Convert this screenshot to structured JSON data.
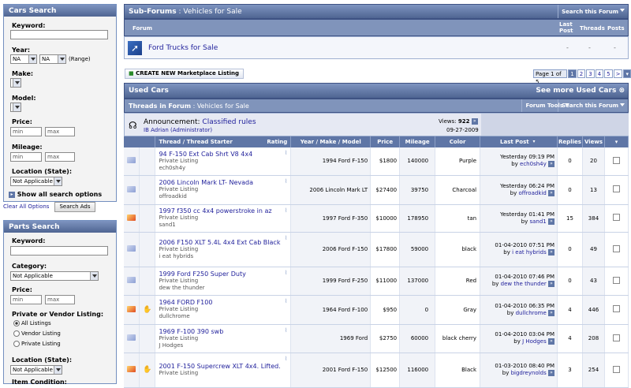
{
  "cars_search": {
    "title": "Cars Search",
    "keyword_label": "Keyword:",
    "year_label": "Year:",
    "year_from": "NA",
    "year_to": "NA",
    "range": "(Range)",
    "make_label": "Make:",
    "model_label": "Model:",
    "price_label": "Price:",
    "min": "min",
    "max": "max",
    "mileage_label": "Mileage:",
    "location_label": "Location (State):",
    "location_value": "Not Applicable",
    "show_all": "Show all search options",
    "clear": "Clear All Options",
    "search_ads": "Search Ads"
  },
  "parts_search": {
    "title": "Parts Search",
    "keyword_label": "Keyword:",
    "category_label": "Category:",
    "category_value": "Not Applicable",
    "price_label": "Price:",
    "min": "min",
    "max": "max",
    "vendor_label": "Private or Vendor Listing:",
    "options": [
      "All Listings",
      "Vendor Listing",
      "Private Listing"
    ],
    "location_label": "Location (State):",
    "location_value": "Not Applicable",
    "condition_label": "Item Condition:"
  },
  "subforums": {
    "title": "Sub-Forums",
    "crumb": "Vehicles for Sale",
    "search": "Search this Forum",
    "col_forum": "Forum",
    "col_last_post": "Last Post",
    "col_threads": "Threads",
    "col_posts": "Posts",
    "row_name": "Ford Trucks for Sale",
    "row_last": "-",
    "row_threads": "-",
    "row_posts": "-"
  },
  "listing_btn": "CREATE NEW Marketplace Listing",
  "pagination": {
    "label": "Page 1 of 5",
    "pages": [
      "1",
      "2",
      "3",
      "4",
      "5",
      ">"
    ]
  },
  "used_cars": {
    "title": "Used Cars",
    "more": "See more Used Cars"
  },
  "threads_bar": {
    "title": "Threads in Forum",
    "crumb": "Vehicles for Sale",
    "tools": "Forum Tools",
    "search": "Search this Forum"
  },
  "announcement": {
    "label": "Announcement:",
    "title": "Classified rules",
    "author": "IB Adrian (Administrator)",
    "views_label": "Views:",
    "views": "922",
    "date": "09-27-2009"
  },
  "columns": {
    "thread": "Thread / Thread Starter",
    "rating": "Rating",
    "ymm": "Year / Make / Model",
    "price": "Price",
    "mileage": "Mileage",
    "color": "Color",
    "last_post": "Last Post",
    "replies": "Replies",
    "views": "Views"
  },
  "rows": [
    {
      "title": "94 F-150 Ext Cab Shrt V8 4x4",
      "type": "Private Listing",
      "starter": "ech0sh4y",
      "ymm": "1994 Ford F-150",
      "price": "$1800",
      "mileage": "140000",
      "color": "Purple",
      "date": "Yesterday 09:19 PM",
      "by": "ech0sh4y",
      "replies": "0",
      "views": "20",
      "icon": "blue"
    },
    {
      "title": "2006 Lincoln Mark LT- Nevada",
      "type": "Private Listing",
      "starter": "offroadkid",
      "ymm": "2006 Lincoln Mark LT",
      "price": "$27400",
      "mileage": "39750",
      "color": "Charcoal",
      "date": "Yesterday 06:24 PM",
      "by": "offroadkid",
      "replies": "0",
      "views": "13",
      "icon": "blue"
    },
    {
      "title": "1997 f350 cc 4x4 powerstroke in az",
      "type": "Private Listing",
      "starter": "sand1",
      "ymm": "1997 Ford F-350",
      "price": "$10000",
      "mileage": "178950",
      "color": "tan",
      "date": "Yesterday 01:41 PM",
      "by": "sand1",
      "replies": "15",
      "views": "384",
      "icon": "red"
    },
    {
      "title": "2006 F150 XLT 5.4L 4x4 Ext Cab Black",
      "type": "Private Listing",
      "starter": "i eat hybrids",
      "ymm": "2006 Ford F-150",
      "price": "$17800",
      "mileage": "59000",
      "color": "black",
      "date": "01-04-2010 07:51 PM",
      "by": "i eat hybrids",
      "replies": "0",
      "views": "49",
      "icon": "blue"
    },
    {
      "title": "1999 Ford F250 Super Duty",
      "type": "Private Listing",
      "starter": "dew the thunder",
      "ymm": "1999 Ford F-250",
      "price": "$11000",
      "mileage": "137000",
      "color": "Red",
      "date": "01-04-2010 07:46 PM",
      "by": "dew the thunder",
      "replies": "0",
      "views": "43",
      "icon": "blue"
    },
    {
      "title": "1964 FORD F100",
      "type": "Private Listing",
      "starter": "dullchrome",
      "ymm": "1964 Ford F-100",
      "price": "$950",
      "mileage": "0",
      "color": "Gray",
      "date": "01-04-2010 06:35 PM",
      "by": "dullchrome",
      "replies": "4",
      "views": "446",
      "icon": "red"
    },
    {
      "title": "1969 F-100 390 swb",
      "type": "Private Listing",
      "starter": "J Hodges",
      "ymm": "1969 Ford",
      "price": "$2750",
      "mileage": "60000",
      "color": "black cherry",
      "date": "01-04-2010 03:04 PM",
      "by": "J Hodges",
      "replies": "4",
      "views": "208",
      "icon": "blue"
    },
    {
      "title": "2001 F-150 Supercrew XLT 4x4. Lifted.",
      "type": "Private Listing",
      "starter": "",
      "ymm": "2001 Ford F-150",
      "price": "$12500",
      "mileage": "116000",
      "color": "Black",
      "date": "01-03-2010 08:40 PM",
      "by": "bigdreynolds",
      "replies": "3",
      "views": "254",
      "icon": "red"
    }
  ]
}
